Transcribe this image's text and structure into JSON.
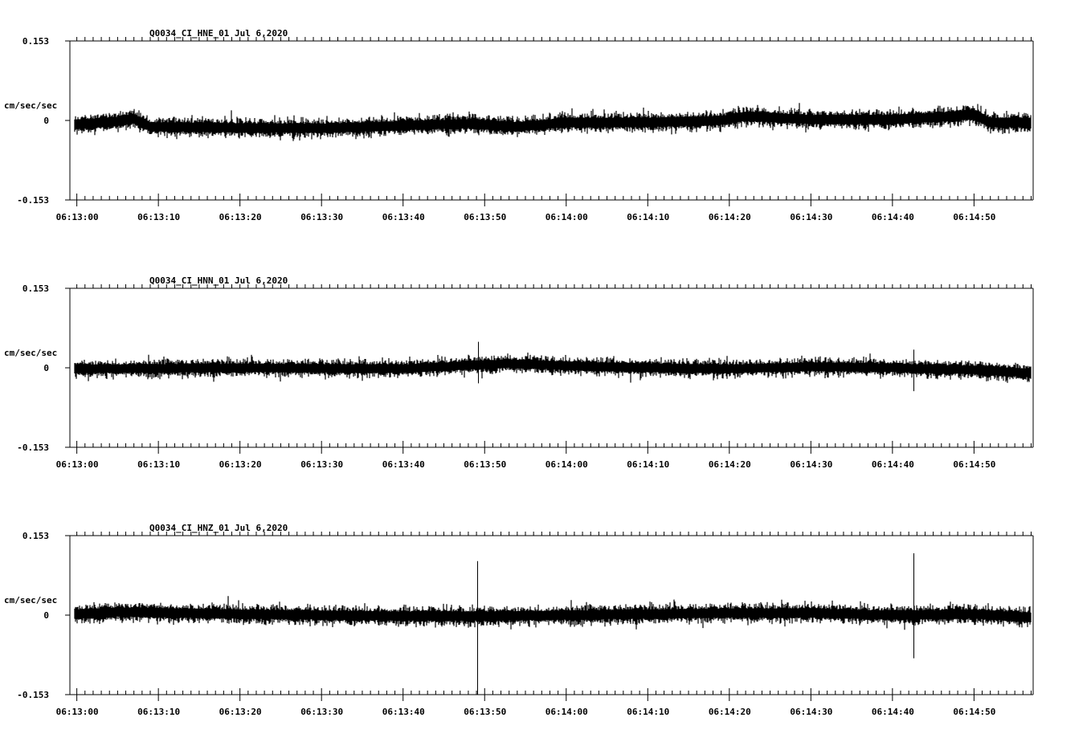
{
  "chart_data": [
    {
      "type": "line",
      "title": "Q0034_CI_HNE_01  Jul 6,2020",
      "ylabel": "cm/sec/sec",
      "ylim": [
        -0.153,
        0.153
      ],
      "y_tick_labels": [
        "0.153",
        "0",
        "-0.153"
      ],
      "x_tick_labels": [
        "06:13:00",
        "06:13:10",
        "06:13:20",
        "06:13:30",
        "06:13:40",
        "06:13:50",
        "06:14:00",
        "06:14:10",
        "06:14:20",
        "06:14:30",
        "06:14:40",
        "06:14:50"
      ],
      "x_range_seconds": [
        -0.8,
        117.3
      ],
      "grid": false,
      "trace": {
        "start_seconds": -0.2,
        "end_seconds": 117.0,
        "noise_amplitude": 0.012,
        "baseline_points": [
          [
            -0.2,
            -0.008
          ],
          [
            5,
            -0.002
          ],
          [
            7,
            0.004
          ],
          [
            9,
            -0.012
          ],
          [
            20,
            -0.014
          ],
          [
            30,
            -0.015
          ],
          [
            40,
            -0.01
          ],
          [
            48,
            -0.006
          ],
          [
            54,
            -0.012
          ],
          [
            60,
            -0.004
          ],
          [
            70,
            -0.004
          ],
          [
            79,
            0.0
          ],
          [
            82,
            0.008
          ],
          [
            90,
            0.002
          ],
          [
            100,
            0.002
          ],
          [
            108,
            0.008
          ],
          [
            110,
            0.012
          ],
          [
            112,
            -0.004
          ],
          [
            117,
            -0.004
          ]
        ],
        "spikes": []
      }
    },
    {
      "type": "line",
      "title": "Q0034_CI_HNN_01  Jul 6,2020",
      "ylabel": "cm/sec/sec",
      "ylim": [
        -0.153,
        0.153
      ],
      "y_tick_labels": [
        "0.153",
        "0",
        "-0.153"
      ],
      "x_tick_labels": [
        "06:13:00",
        "06:13:10",
        "06:13:20",
        "06:13:30",
        "06:13:40",
        "06:13:50",
        "06:14:00",
        "06:14:10",
        "06:14:20",
        "06:14:30",
        "06:14:40",
        "06:14:50"
      ],
      "x_range_seconds": [
        -0.8,
        117.3
      ],
      "grid": false,
      "trace": {
        "start_seconds": -0.2,
        "end_seconds": 117.0,
        "noise_amplitude": 0.011,
        "baseline_points": [
          [
            -0.2,
            -0.002
          ],
          [
            20,
            0.0
          ],
          [
            40,
            -0.002
          ],
          [
            47,
            0.004
          ],
          [
            53,
            0.008
          ],
          [
            60,
            0.004
          ],
          [
            70,
            0.0
          ],
          [
            80,
            -0.002
          ],
          [
            90,
            0.002
          ],
          [
            100,
            0.0
          ],
          [
            110,
            -0.004
          ],
          [
            117,
            -0.01
          ]
        ],
        "spikes": [
          [
            49.2,
            0.05,
            -0.03
          ],
          [
            102.6,
            0.035,
            -0.045
          ]
        ]
      }
    },
    {
      "type": "line",
      "title": "Q0034_CI_HNZ_01  Jul 6,2020",
      "ylabel": "cm/sec/sec",
      "ylim": [
        -0.153,
        0.153
      ],
      "y_tick_labels": [
        "0.153",
        "0",
        "-0.153"
      ],
      "x_tick_labels": [
        "06:13:00",
        "06:13:10",
        "06:13:20",
        "06:13:30",
        "06:13:40",
        "06:13:50",
        "06:14:00",
        "06:14:10",
        "06:14:20",
        "06:14:30",
        "06:14:40",
        "06:14:50"
      ],
      "x_range_seconds": [
        -0.8,
        117.3
      ],
      "grid": false,
      "trace": {
        "start_seconds": -0.2,
        "end_seconds": 117.0,
        "noise_amplitude": 0.012,
        "baseline_points": [
          [
            -0.2,
            0.002
          ],
          [
            5,
            0.006
          ],
          [
            20,
            0.002
          ],
          [
            40,
            -0.002
          ],
          [
            50,
            -0.002
          ],
          [
            60,
            0.0
          ],
          [
            70,
            0.002
          ],
          [
            80,
            0.004
          ],
          [
            90,
            0.004
          ],
          [
            100,
            0.0
          ],
          [
            110,
            0.002
          ],
          [
            117,
            -0.004
          ]
        ],
        "spikes": [
          [
            49.1,
            0.104,
            -0.153
          ],
          [
            102.6,
            0.119,
            -0.083
          ]
        ]
      }
    }
  ]
}
